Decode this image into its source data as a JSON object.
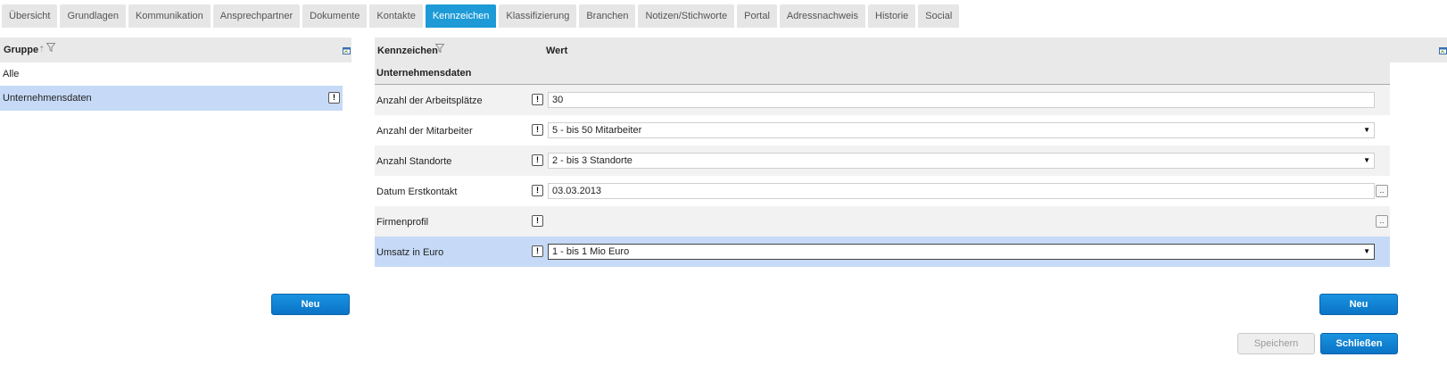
{
  "tabs": [
    {
      "label": "Übersicht"
    },
    {
      "label": "Grundlagen"
    },
    {
      "label": "Kommunikation"
    },
    {
      "label": "Ansprechpartner"
    },
    {
      "label": "Dokumente"
    },
    {
      "label": "Kontakte"
    },
    {
      "label": "Kennzeichen",
      "active": true
    },
    {
      "label": "Klassifizierung"
    },
    {
      "label": "Branchen"
    },
    {
      "label": "Notizen/Stichworte"
    },
    {
      "label": "Portal"
    },
    {
      "label": "Adressnachweis"
    },
    {
      "label": "Historie"
    },
    {
      "label": "Social"
    }
  ],
  "left_panel": {
    "column_header": "Gruppe",
    "rows": [
      {
        "label": "Alle"
      },
      {
        "label": "Unternehmensdaten",
        "selected": true,
        "badge": "!"
      }
    ],
    "new_button": "Neu"
  },
  "right_panel": {
    "column_headers": {
      "key": "Kennzeichen",
      "value": "Wert"
    },
    "section_title": "Unternehmensdaten",
    "rows": [
      {
        "label": "Anzahl der Arbeitsplätze",
        "badge": "!",
        "value": "30",
        "type": "text"
      },
      {
        "label": "Anzahl der Mitarbeiter",
        "badge": "!",
        "value": "5 - bis 50 Mitarbeiter",
        "type": "select"
      },
      {
        "label": "Anzahl Standorte",
        "badge": "!",
        "value": "2 - bis 3 Standorte",
        "type": "select"
      },
      {
        "label": "Datum Erstkontakt",
        "badge": "!",
        "value": "03.03.2013",
        "type": "date",
        "more": ".."
      },
      {
        "label": "Firmenprofil",
        "badge": "!",
        "value": "",
        "type": "text-area",
        "more": ".."
      },
      {
        "label": "Umsatz in Euro",
        "badge": "!",
        "value": "1 - bis 1 Mio Euro",
        "type": "select",
        "selected": true
      }
    ],
    "new_button": "Neu"
  },
  "footer": {
    "save_button": "Speichern",
    "close_button": "Schließen"
  },
  "colors": {
    "accent": "#1e9bd7",
    "selection": "#c6daf7",
    "button_blue": "#0a73c6"
  }
}
